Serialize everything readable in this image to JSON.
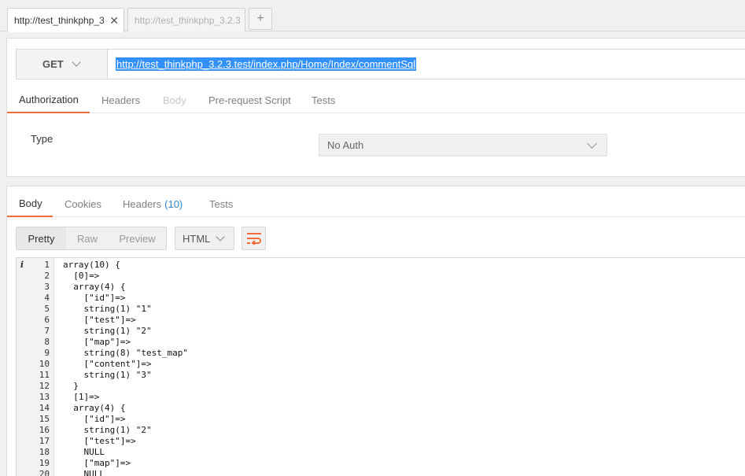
{
  "tabs": [
    {
      "label": "http://test_thinkphp_3",
      "active": true,
      "close": "✕"
    },
    {
      "label": "http://test_thinkphp_3.2.3",
      "active": false
    }
  ],
  "tab_add": "+",
  "request": {
    "method": "GET",
    "url": "http://test_thinkphp_3.2.3.test/index.php/Home/Index/commentSql",
    "tabs": [
      "Authorization",
      "Headers",
      "Body",
      "Pre-request Script",
      "Tests"
    ],
    "auth": {
      "type_label": "Type",
      "type_value": "No Auth"
    }
  },
  "response": {
    "tabs": {
      "body": "Body",
      "cookies": "Cookies",
      "headers": "Headers",
      "headers_count": "(10)",
      "tests": "Tests"
    },
    "views": [
      "Pretty",
      "Raw",
      "Preview"
    ],
    "language": "HTML",
    "info_marker": "i",
    "lines": [
      "array(10) {",
      "  [0]=>",
      "  array(4) {",
      "    [\"id\"]=>",
      "    string(1) \"1\"",
      "    [\"test\"]=>",
      "    string(1) \"2\"",
      "    [\"map\"]=>",
      "    string(8) \"test_map\"",
      "    [\"content\"]=>",
      "    string(1) \"3\"",
      "  }",
      "  [1]=>",
      "  array(4) {",
      "    [\"id\"]=>",
      "    string(1) \"2\"",
      "    [\"test\"]=>",
      "    NULL",
      "    [\"map\"]=>",
      "    NULL"
    ]
  },
  "colors": {
    "accent": "#f26b3a",
    "selection": "#3390ff",
    "count": "#2f88d6"
  }
}
